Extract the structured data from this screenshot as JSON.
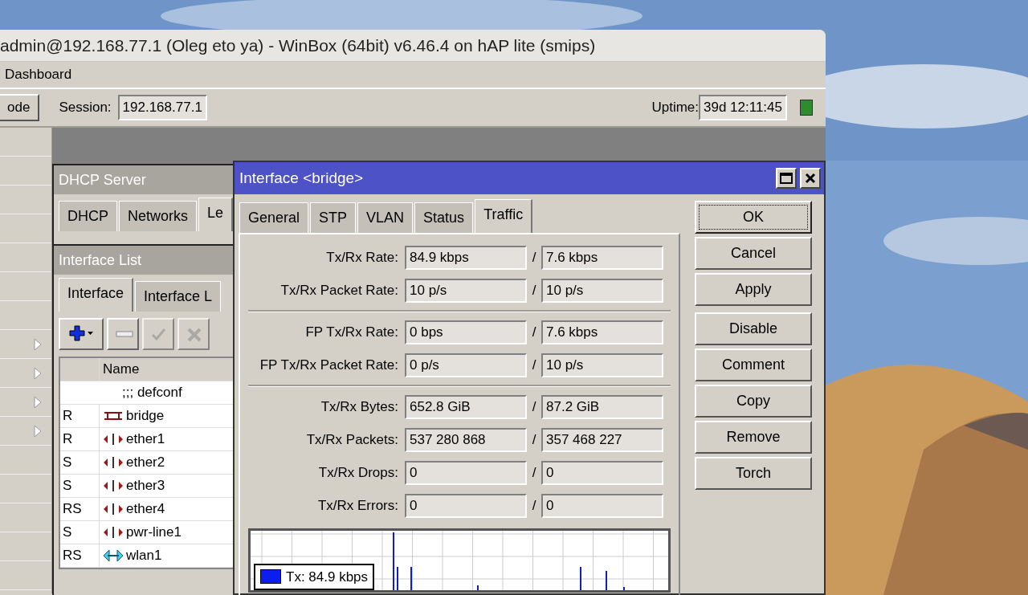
{
  "window": {
    "title": "admin@192.168.77.1 (Oleg eto ya) - WinBox (64bit) v6.46.4 on hAP lite (smips)"
  },
  "menu": [
    "Dashboard"
  ],
  "toolbar": {
    "button": "ode",
    "session_label": "Session:",
    "session": "192.168.77.1",
    "uptime_label": "Uptime:",
    "uptime": "39d 12:11:45",
    "connected": true
  },
  "sidebar": {
    "items": [
      {
        "kind": "plain"
      },
      {
        "kind": "plain"
      },
      {
        "kind": "plain"
      },
      {
        "kind": "plain"
      },
      {
        "kind": "plain"
      },
      {
        "kind": "plain"
      },
      {
        "kind": "plain"
      },
      {
        "kind": "submenu"
      },
      {
        "kind": "submenu"
      },
      {
        "kind": "submenu"
      },
      {
        "kind": "submenu"
      },
      {
        "kind": "plain"
      },
      {
        "kind": "plain"
      },
      {
        "kind": "plain"
      },
      {
        "kind": "plain"
      },
      {
        "kind": "plain"
      }
    ]
  },
  "dhcp_window": {
    "title": "DHCP Server",
    "tabs": [
      {
        "label": "DHCP",
        "selected": false
      },
      {
        "label": "Networks",
        "selected": false
      },
      {
        "label": "Le",
        "selected": true
      }
    ]
  },
  "interface_list": {
    "title": "Interface List",
    "tabs": [
      {
        "label": "Interface",
        "selected": true
      },
      {
        "label": "Interface L",
        "selected": false
      }
    ],
    "tools": [
      {
        "kind": "add",
        "disabled": false
      },
      {
        "kind": "remove",
        "disabled": false
      },
      {
        "kind": "enable",
        "disabled": true
      },
      {
        "kind": "disable",
        "disabled": true
      }
    ],
    "columns": [
      "Name"
    ],
    "rows": [
      {
        "flags": "",
        "name": ";;; defconf",
        "kind": "comment"
      },
      {
        "flags": "R",
        "name": "bridge",
        "kind": "bridge"
      },
      {
        "flags": "R",
        "name": "ether1",
        "kind": "ether"
      },
      {
        "flags": "S",
        "name": "ether2",
        "kind": "ether"
      },
      {
        "flags": "S",
        "name": "ether3",
        "kind": "ether"
      },
      {
        "flags": "RS",
        "name": "ether4",
        "kind": "ether"
      },
      {
        "flags": "S",
        "name": "pwr-line1",
        "kind": "ether"
      },
      {
        "flags": "RS",
        "name": "wlan1",
        "kind": "wlan"
      }
    ]
  },
  "dialog": {
    "title": "Interface <bridge>",
    "tabs": [
      {
        "label": "General",
        "selected": false
      },
      {
        "label": "STP",
        "selected": false
      },
      {
        "label": "VLAN",
        "selected": false
      },
      {
        "label": "Status",
        "selected": false
      },
      {
        "label": "Traffic",
        "selected": true
      }
    ],
    "groups": [
      [
        {
          "label": "Tx/Rx Rate:",
          "tx": "84.9 kbps",
          "separator": "/",
          "rx": "7.6 kbps"
        },
        {
          "label": "Tx/Rx Packet Rate:",
          "tx": "10 p/s",
          "separator": "/",
          "rx": "10 p/s"
        }
      ],
      [
        {
          "label": "FP Tx/Rx Rate:",
          "tx": "0 bps",
          "separator": "/",
          "rx": "7.6 kbps"
        },
        {
          "label": "FP Tx/Rx Packet Rate:",
          "tx": "0 p/s",
          "separator": "/",
          "rx": "10 p/s"
        }
      ],
      [
        {
          "label": "Tx/Rx Bytes:",
          "tx": "652.8 GiB",
          "separator": "/",
          "rx": "87.2 GiB"
        },
        {
          "label": "Tx/Rx Packets:",
          "tx": "537 280 868",
          "separator": "/",
          "rx": "357 468 227"
        },
        {
          "label": "Tx/Rx Drops:",
          "tx": "0",
          "separator": "/",
          "rx": "0"
        },
        {
          "label": "Tx/Rx Errors:",
          "tx": "0",
          "separator": "/",
          "rx": "0"
        }
      ]
    ],
    "legend": {
      "label": "Tx: 84.9 kbps",
      "color": "#0b1ef0"
    },
    "button_groups": [
      [
        {
          "label": "OK",
          "default": true
        },
        {
          "label": "Cancel",
          "default": false
        },
        {
          "label": "Apply",
          "default": false
        }
      ],
      [
        {
          "label": "Disable",
          "default": false
        },
        {
          "label": "Comment",
          "default": false
        },
        {
          "label": "Copy",
          "default": false
        },
        {
          "label": "Remove",
          "default": false
        },
        {
          "label": "Torch",
          "default": false
        }
      ]
    ]
  }
}
